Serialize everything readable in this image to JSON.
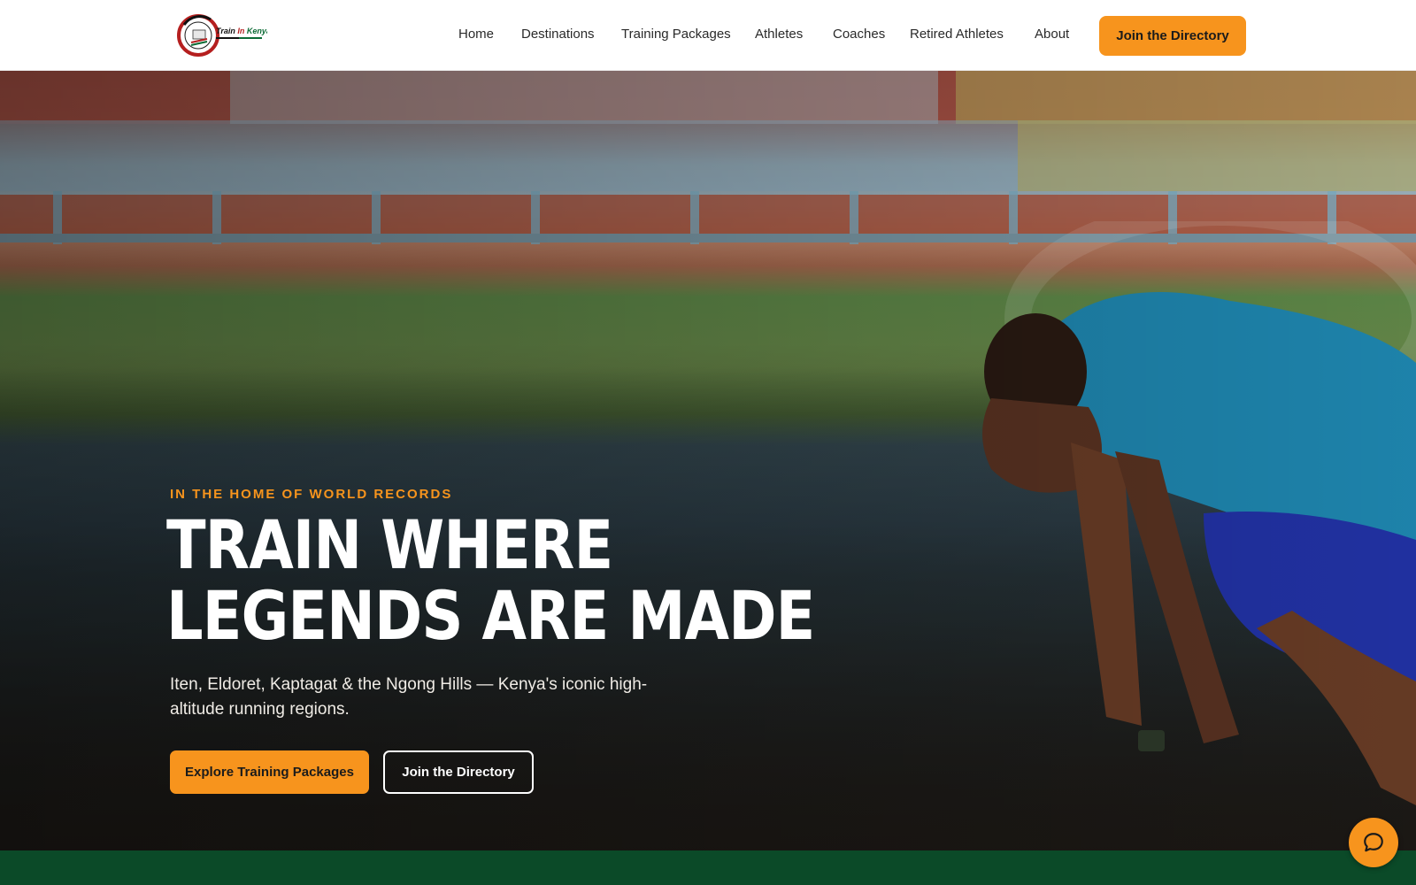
{
  "brand": {
    "logo_text": "Train In Kenya",
    "accent_color": "#F7941D",
    "green_color": "#0b4a28"
  },
  "nav": {
    "items": [
      {
        "label": "Home"
      },
      {
        "label": "Destinations"
      },
      {
        "label": "Training Packages"
      },
      {
        "label": "Athletes"
      },
      {
        "label": "Coaches"
      },
      {
        "label": "Retired Athletes"
      },
      {
        "label": "About"
      }
    ],
    "cta_label": "Join the Directory"
  },
  "hero": {
    "eyebrow": "IN THE HOME OF WORLD RECORDS",
    "headline_line1": "TRAIN WHERE",
    "headline_line2": "LEGENDS ARE MADE",
    "subtitle": "Iten, Eldoret, Kaptagat & the Ngong Hills — Kenya's iconic high-altitude running regions.",
    "primary_button": "Explore Training Packages",
    "secondary_button": "Join the Directory"
  },
  "chat": {
    "icon": "chat-bubble-icon"
  }
}
